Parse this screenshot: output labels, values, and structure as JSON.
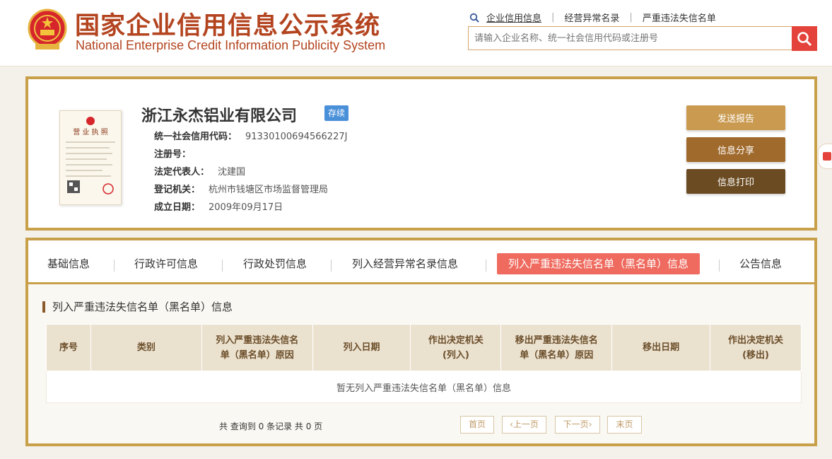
{
  "header": {
    "title_cn": "国家企业信用信息公示系统",
    "title_en": "National Enterprise Credit Information Publicity System",
    "nav": [
      "企业信用信息",
      "经营异常名录",
      "严重违法失信名单"
    ],
    "search_placeholder": "请输入企业名称、统一社会信用代码或注册号",
    "icons": {
      "emblem": "national-emblem-icon",
      "search": "search-icon",
      "nav": "magnifier-icon"
    }
  },
  "company": {
    "name": "浙江永杰铝业有限公司",
    "status": "存续",
    "license_image": {
      "title": "营业执照"
    },
    "fields": [
      {
        "label": "统一社会信用代码：",
        "value": "91330100694566227J"
      },
      {
        "label": "注册号：",
        "value": ""
      },
      {
        "label": "法定代表人：",
        "value": "沈建国"
      },
      {
        "label": "登记机关：",
        "value": "杭州市钱塘区市场监督管理局"
      },
      {
        "label": "成立日期：",
        "value": "2009年09月17日"
      }
    ],
    "actions": [
      "发送报告",
      "信息分享",
      "信息打印"
    ]
  },
  "tabs": [
    "基础信息",
    "行政许可信息",
    "行政处罚信息",
    "列入经营异常名录信息",
    "列入严重违法失信名单（黑名单）信息",
    "公告信息"
  ],
  "active_tab": 4,
  "section": {
    "title": "列入严重违法失信名单（黑名单）信息",
    "columns": [
      [
        "序号"
      ],
      [
        "类别"
      ],
      [
        "列入严重违法失信名",
        "单（黑名单）原因"
      ],
      [
        "列入日期"
      ],
      [
        "作出决定机关",
        "(列入)"
      ],
      [
        "移出严重违法失信名",
        "单（黑名单）原因"
      ],
      [
        "移出日期"
      ],
      [
        "作出决定机关",
        "(移出)"
      ]
    ],
    "empty_text": "暂无列入严重违法失信名单（黑名单）信息",
    "pager": {
      "summary": "共 查询到 0 条记录 共 0 页",
      "first": "首页",
      "prev": "上一页",
      "next": "下一页",
      "last": "末页"
    }
  },
  "colors": {
    "brand": "#b3441f",
    "gold": "#c9a04a",
    "active_tab": "#ef6b5f",
    "status_badge": "#4a90d9",
    "search_btn": "#e4433b"
  }
}
